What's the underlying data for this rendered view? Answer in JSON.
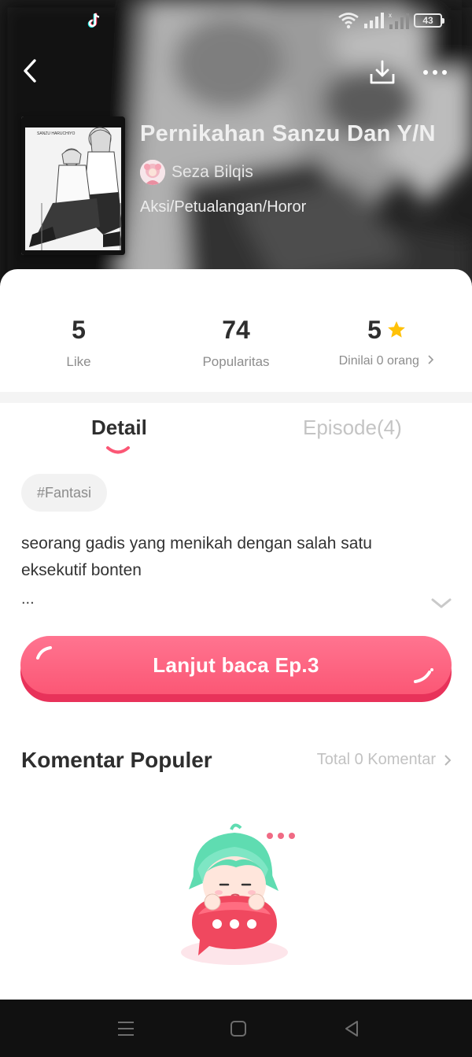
{
  "status_bar": {
    "battery_level": "43",
    "icons": [
      "tiktok-icon",
      "wifi-icon",
      "signal-icon",
      "signal-no-service-icon",
      "battery-icon"
    ]
  },
  "header": {
    "icons": [
      "back-arrow-icon",
      "download-icon",
      "more-dots-icon"
    ]
  },
  "comic": {
    "title": "Pernikahan Sanzu Dan Y/N",
    "author": "Seza Bilqis",
    "genres": "Aksi/Petualangan/Horor"
  },
  "stats": {
    "likes_value": "5",
    "likes_label": "Like",
    "popularity_value": "74",
    "popularity_label": "Popularitas",
    "rating_value": "5",
    "rating_label": "Dinilai 0 orang"
  },
  "tabs": {
    "detail": "Detail",
    "episodes": "Episode(4)"
  },
  "tag": "#Fantasi",
  "synopsis": {
    "text": "seorang gadis yang menikah dengan salah satu eksekutif bonten",
    "ellipsis": "..."
  },
  "continue_button": {
    "label": "Lanjut baca Ep.3"
  },
  "comments": {
    "title": "Komentar Populer",
    "total": "Total 0 Komentar"
  },
  "colors": {
    "accent_pink": "#fb5775",
    "star": "#ffc107",
    "muted_text": "#8d8d8d"
  },
  "nav_bar": {
    "icons": [
      "menu-icon",
      "home-square-icon",
      "back-triangle-icon"
    ]
  }
}
